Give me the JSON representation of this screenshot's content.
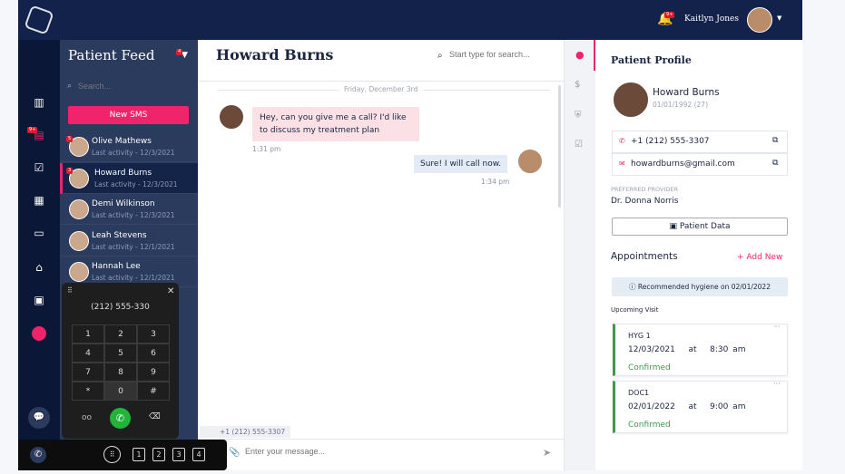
{
  "topbar": {
    "notifications_badge": "9+",
    "user_name": "Kaitlyn Jones"
  },
  "rail": {
    "messages_badge": "9+"
  },
  "feed": {
    "title": "Patient Feed",
    "filter_badge": "4",
    "search_placeholder": "Search...",
    "new_sms": "New SMS",
    "items": [
      {
        "name": "Olive Mathews",
        "activity": "Last activity - 12/3/2021",
        "badge": "5"
      },
      {
        "name": "Howard Burns",
        "activity": "Last activity - 12/3/2021",
        "badge": "3"
      },
      {
        "name": "Demi Wilkinson",
        "activity": "Last activity - 12/3/2021"
      },
      {
        "name": "Leah Stevens",
        "activity": "Last activity - 12/1/2021"
      },
      {
        "name": "Hannah Lee",
        "activity": "Last activity - 12/1/2021"
      }
    ]
  },
  "chat": {
    "title": "Howard Burns",
    "search_placeholder": "Start type for search...",
    "date": "Friday, December 3rd",
    "messages": [
      {
        "text": "Hey, can you give me a call? I'd like to discuss my treatment plan",
        "time": "1:31 pm"
      },
      {
        "text": "Sure! I will call now.",
        "time": "1:34 pm"
      }
    ],
    "from_number": "+1 (212) 555-3307",
    "input_placeholder": "Enter your message..."
  },
  "dialer": {
    "number": "(212) 555-330",
    "keys": [
      "1",
      "2",
      "3",
      "4",
      "5",
      "6",
      "7",
      "8",
      "9",
      "*",
      "0",
      "#"
    ]
  },
  "phonebar": {
    "lines": [
      "1",
      "2",
      "3",
      "4"
    ]
  },
  "profile": {
    "title": "Patient Profile",
    "name": "Howard Burns",
    "dob": "01/01/1992 (27)",
    "phone": "+1 (212) 555-3307",
    "email": "howardburns@gmail.com",
    "provider_label": "PREFERRED PROVIDER",
    "provider": "Dr. Donna Norris",
    "patient_data": "Patient Data",
    "appointments": "Appointments",
    "add_new": "Add New",
    "recommended": "Recommended hygiene on 02/01/2022",
    "upcoming": "Upcoming Visit",
    "visits": [
      {
        "code": "HYG 1",
        "date": "12/03/2021",
        "at": "at",
        "time": "8:30 am",
        "status": "Confirmed"
      },
      {
        "code": "DOC1",
        "date": "02/01/2022",
        "at": "at",
        "time": "9:00 am",
        "status": "Confirmed"
      }
    ]
  },
  "colors": {
    "accent": "#f0246a",
    "navy": "#12224a",
    "confirmed": "#3d9b4a",
    "call": "#22b33a"
  }
}
